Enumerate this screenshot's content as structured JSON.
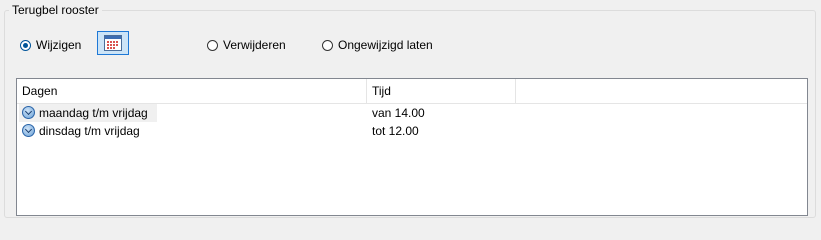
{
  "group": {
    "title": "Terugbel rooster"
  },
  "radios": [
    {
      "label": "Wijzigen",
      "checked": true
    },
    {
      "label": "Verwijderen",
      "checked": false
    },
    {
      "label": "Ongewijzigd laten",
      "checked": false
    }
  ],
  "calendar_button": {
    "icon": "calendar-icon"
  },
  "table": {
    "columns": [
      "Dagen",
      "Tijd"
    ],
    "rows": [
      {
        "dagen": "maandag t/m vrijdag",
        "tijd": "van 14.00",
        "icon": "clock-icon",
        "selected": true
      },
      {
        "dagen": "dinsdag t/m vrijdag",
        "tijd": "tot 12.00",
        "icon": "clock-icon",
        "selected": false
      }
    ]
  },
  "colors": {
    "accent": "#005499",
    "button_bg": "#cce4f7",
    "button_border": "#1e78d6"
  }
}
